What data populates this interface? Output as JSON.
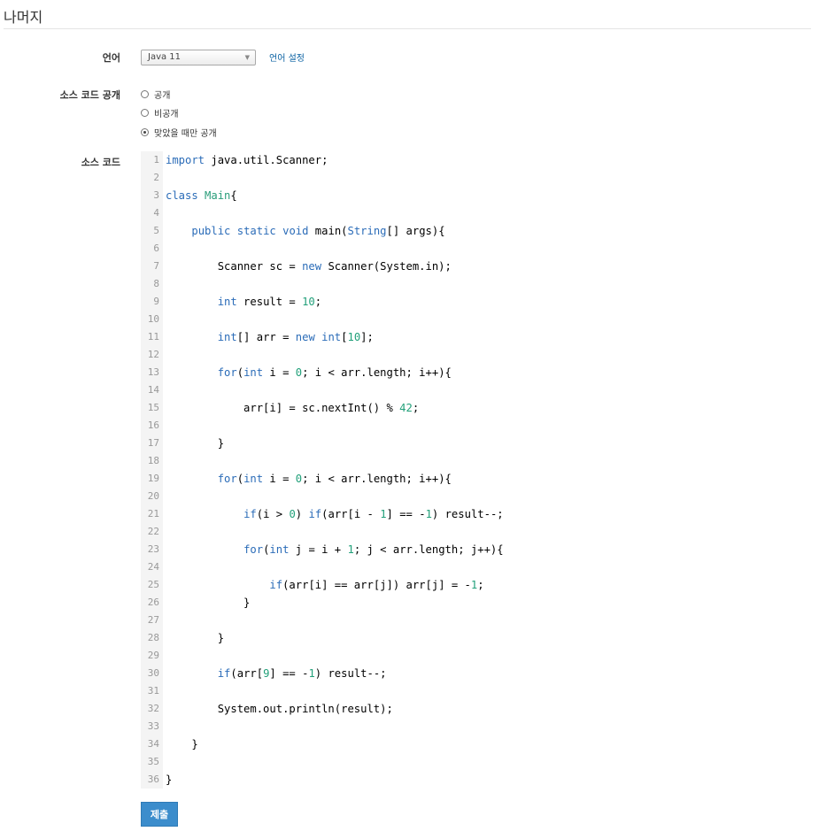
{
  "page": {
    "title": "나머지"
  },
  "form": {
    "language": {
      "label": "언어",
      "selected": "Java 11",
      "settings_link": "언어 설정"
    },
    "visibility": {
      "label": "소스 코드 공개",
      "options": [
        {
          "label": "공개",
          "checked": false
        },
        {
          "label": "비공개",
          "checked": false
        },
        {
          "label": "맞았을 때만 공개",
          "checked": true
        }
      ]
    },
    "source": {
      "label": "소스 코드",
      "lines": [
        "import java.util.Scanner;",
        "",
        "class Main{",
        "",
        "    public static void main(String[] args){",
        "",
        "        Scanner sc = new Scanner(System.in);",
        "",
        "        int result = 10;",
        "",
        "        int[] arr = new int[10];",
        "",
        "        for(int i = 0; i < arr.length; i++){",
        "",
        "            arr[i] = sc.nextInt() % 42;",
        "",
        "        }",
        "",
        "        for(int i = 0; i < arr.length; i++){",
        "",
        "            if(i > 0) if(arr[i - 1] == -1) result--;",
        "",
        "            for(int j = i + 1; j < arr.length; j++){",
        "",
        "                if(arr[i] == arr[j]) arr[j] = -1;",
        "            }",
        "",
        "        }",
        "",
        "        if(arr[9] == -1) result--;",
        "",
        "        System.out.println(result);",
        "",
        "    }",
        "",
        "}"
      ]
    },
    "submit_label": "제출"
  },
  "colors": {
    "link": "#0b62a3",
    "keyword": "#2b6cb8",
    "number": "#22a07a",
    "button": "#3c8dcc"
  }
}
